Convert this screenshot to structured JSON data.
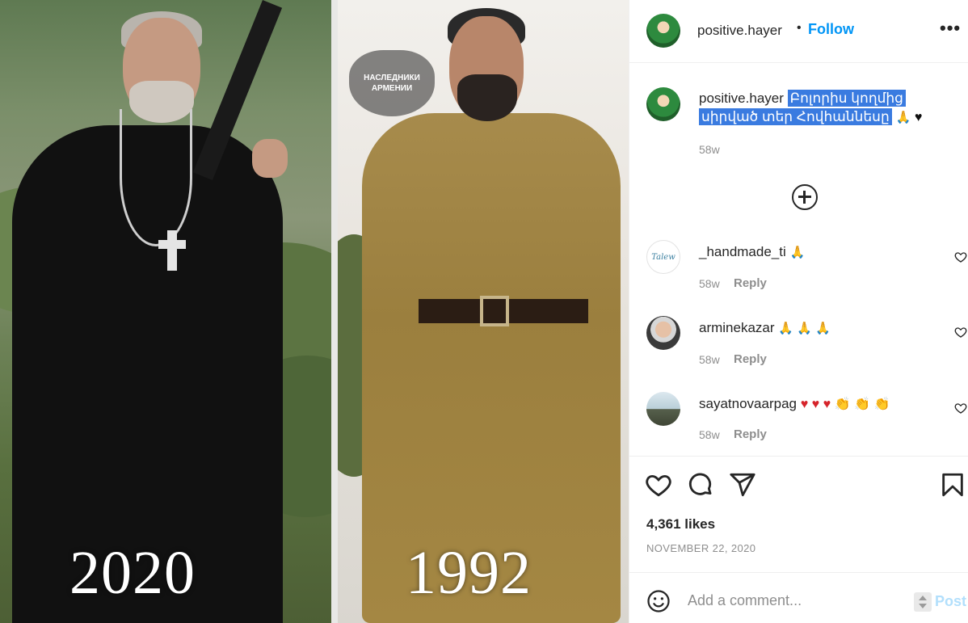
{
  "post": {
    "image": {
      "left_year": "2020",
      "right_year": "1992",
      "emblem_text": "НАСЛЕДНИКИ АРМЕНИИ",
      "description_icons": [
        "priest-figure",
        "soldier-figure",
        "rifle-icon",
        "cross-icon"
      ]
    },
    "header": {
      "username": "positive.hayer",
      "bullet": "•",
      "follow_label": "Follow",
      "more_label": "•••"
    },
    "caption": {
      "username": "positive.hayer",
      "text_line1": "Բոլորիս կողմից",
      "text_line2": "սիրված տեր Հովհաննեսը",
      "emoji_pray": "🙏",
      "emoji_heart": "♥",
      "time": "58w"
    },
    "comments": [
      {
        "username": "_handmade_ti",
        "emojis": "🙏",
        "time": "58w",
        "reply_label": "Reply",
        "avatar_text": "Talew"
      },
      {
        "username": "arminekazar",
        "emojis": "🙏 🙏 🙏",
        "time": "58w",
        "reply_label": "Reply"
      },
      {
        "username": "sayatnovaarpag",
        "hearts": "♥ ♥ ♥",
        "claps": "👏 👏 👏",
        "time": "58w",
        "reply_label": "Reply"
      }
    ],
    "actions": {
      "likes": "4,361 likes",
      "date": "NOVEMBER 22, 2020"
    },
    "add_comment": {
      "placeholder": "Add a comment...",
      "post_label": "Post"
    }
  },
  "colors": {
    "accent": "#0095f6",
    "post_disabled": "#b2dffc",
    "highlight": "#3a7be0",
    "muted": "#8e8e8e",
    "text": "#262626"
  }
}
